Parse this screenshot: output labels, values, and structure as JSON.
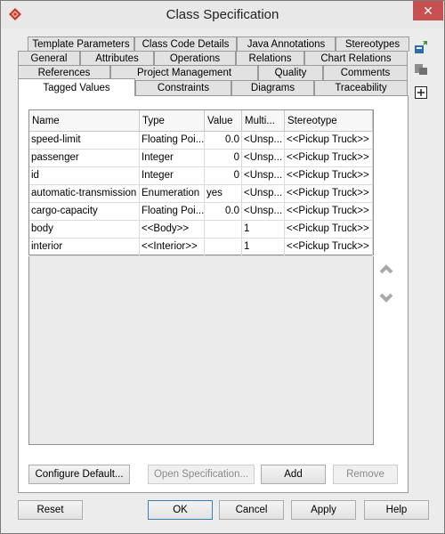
{
  "window": {
    "title": "Class Specification"
  },
  "tabs": {
    "row1": [
      "Template Parameters",
      "Class Code Details",
      "Java Annotations",
      "Stereotypes"
    ],
    "row2": [
      "General",
      "Attributes",
      "Operations",
      "Relations",
      "Chart Relations"
    ],
    "row3": [
      "References",
      "Project Management",
      "Quality",
      "Comments"
    ],
    "row4": [
      "Tagged Values",
      "Constraints",
      "Diagrams",
      "Traceability"
    ],
    "active": "Tagged Values"
  },
  "table": {
    "columns": [
      "Name",
      "Type",
      "Value",
      "Multi...",
      "Stereotype"
    ],
    "rows": [
      {
        "name": "speed-limit",
        "type": "Floating Poi...",
        "value": "0.0",
        "multi": "<Unsp...",
        "stereotype": "<<Pickup Truck>>"
      },
      {
        "name": "passenger",
        "type": "Integer",
        "value": "0",
        "multi": "<Unsp...",
        "stereotype": "<<Pickup Truck>>"
      },
      {
        "name": "id",
        "type": "Integer",
        "value": "0",
        "multi": "<Unsp...",
        "stereotype": "<<Pickup Truck>>"
      },
      {
        "name": "automatic-transmission",
        "type": "Enumeration",
        "value": "yes",
        "multi": "<Unsp...",
        "stereotype": "<<Pickup Truck>>"
      },
      {
        "name": "cargo-capacity",
        "type": "Floating Poi...",
        "value": "0.0",
        "multi": "<Unsp...",
        "stereotype": "<<Pickup Truck>>"
      },
      {
        "name": "body",
        "type": "<<Body>>",
        "value": "",
        "multi": "1",
        "stereotype": "<<Pickup Truck>>"
      },
      {
        "name": "interior",
        "type": "<<Interior>>",
        "value": "",
        "multi": "1",
        "stereotype": "<<Pickup Truck>>"
      }
    ]
  },
  "panel_buttons": {
    "configure": "Configure Default...",
    "open_spec": "Open Specification...",
    "add": "Add",
    "remove": "Remove"
  },
  "dialog_buttons": {
    "reset": "Reset",
    "ok": "OK",
    "cancel": "Cancel",
    "apply": "Apply",
    "help": "Help"
  },
  "colors": {
    "close_button": "#c75050",
    "arrow": "#a9a9a9"
  },
  "icons": [
    "app-logo-icon",
    "close-icon",
    "stereotype-add-icon",
    "stereotype-edit-icon",
    "expand-icon",
    "move-up-icon",
    "move-down-icon"
  ]
}
